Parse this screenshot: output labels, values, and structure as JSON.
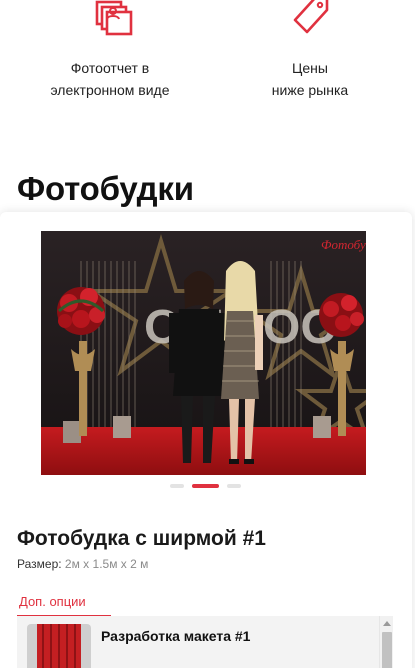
{
  "features": [
    {
      "icon": "photo-report-icon",
      "line1": "Фотоотчет в",
      "line2": "электронном виде"
    },
    {
      "icon": "price-tag-icon",
      "line1": "Цены",
      "line2": "ниже рынка"
    }
  ],
  "section": {
    "title": "Фотобудки"
  },
  "gallery": {
    "image": "photo-of-two-women-at-photo-booth",
    "slides_count": 3,
    "active_slide": 2,
    "watermark": "Фотобудка"
  },
  "product": {
    "title": "Фотобудка с ширмой #1",
    "size_label": "Размер:",
    "size_value": "2м x 1.5м x 2 м"
  },
  "options": {
    "tab_label": "Доп. опции",
    "items": [
      {
        "title": "Разработка макета #1",
        "thumb": "curtain-thumbnail"
      }
    ]
  },
  "colors": {
    "accent": "#e0313f",
    "text": "#1a1a1a",
    "muted": "#8a8a8a"
  }
}
